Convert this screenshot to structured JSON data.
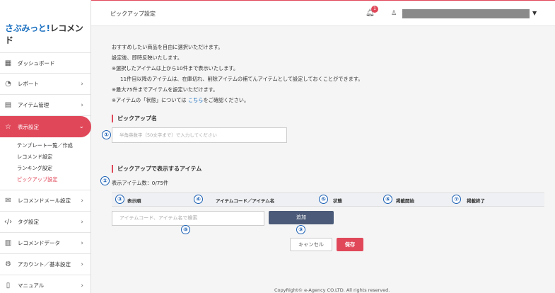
{
  "logo": {
    "part1": "さぶみっと!",
    "part2": "レコメンド"
  },
  "sidebar": {
    "items": [
      {
        "label": "ダッシュボード",
        "icon": "dashboard-icon"
      },
      {
        "label": "レポート",
        "icon": "pie-chart-icon"
      },
      {
        "label": "アイテム管理",
        "icon": "document-icon"
      },
      {
        "label": "表示設定",
        "icon": "star-icon"
      },
      {
        "label": "レコメンドメール設定",
        "icon": "mail-icon"
      },
      {
        "label": "タグ設定",
        "icon": "code-icon"
      },
      {
        "label": "レコメンドデータ",
        "icon": "data-icon"
      },
      {
        "label": "アカウント／基本設定",
        "icon": "gear-icon"
      },
      {
        "label": "マニュアル",
        "icon": "book-icon"
      }
    ],
    "subitems": [
      "テンプレート一覧／作成",
      "レコメンド設定",
      "ランキング設定",
      "ピックアップ設定"
    ]
  },
  "header": {
    "title": "ピックアップ設定",
    "notification_count": "1"
  },
  "main": {
    "desc": [
      "おすすめしたい商品を自由に選択いただけます。",
      "設定後、即時反映いたします。",
      "※選択したアイテムは上から10件まで表示いたします。",
      "11件目以降のアイテムは、在庫切れ、削除アイテムの補てんアイテムとして設定しておくことができます。",
      "※最大75件までアイテムを設定いただけます。"
    ],
    "status_note_prefix": "※アイテムの「状態」については",
    "status_note_link": "こちら",
    "status_note_suffix": "をご確認ください。",
    "pickup_name_title": "ピックアップ名",
    "pickup_name_placeholder": "半角英数字（50文字まで）で入力してください",
    "items_title": "ピックアップで表示するアイテム",
    "item_count": "表示アイテム数：0/75件",
    "columns": [
      "表示順",
      "アイテムコード／アイテム名",
      "状態",
      "掲載開始",
      "掲載終了"
    ],
    "search_placeholder": "アイテムコード、アイテム名で検索",
    "add_label": "追加",
    "cancel_label": "キャンセル",
    "save_label": "保存",
    "markers": [
      "①",
      "②",
      "③",
      "④",
      "⑤",
      "⑥",
      "⑦",
      "⑧",
      "⑨"
    ]
  },
  "footer": "CopyRight© e-Agency CO.LTD. All rights reserved.",
  "colors": {
    "accent": "#e0485a",
    "link": "#1a6fc0",
    "button_dark": "#4b5a78"
  }
}
